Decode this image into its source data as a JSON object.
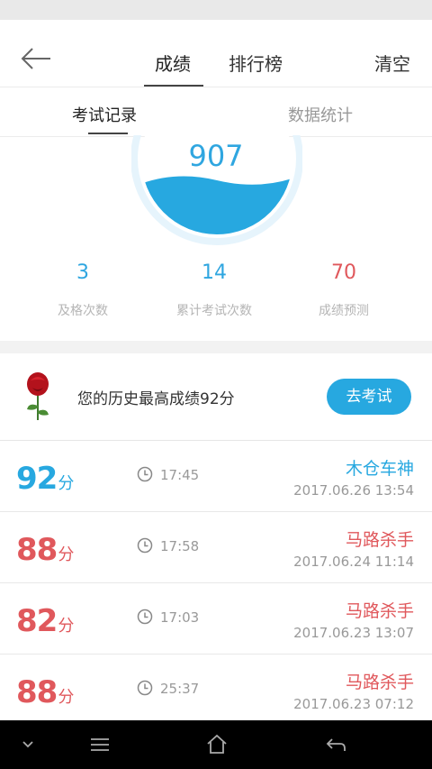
{
  "header": {
    "tabs": [
      {
        "label": "成绩",
        "active": true
      },
      {
        "label": "排行榜",
        "active": false
      }
    ],
    "clear_label": "清空"
  },
  "subtabs": [
    {
      "label": "考试记录",
      "active": true
    },
    {
      "label": "数据统计",
      "active": false
    }
  ],
  "gauge": {
    "score": "907",
    "fill_level": 0.35
  },
  "stats": [
    {
      "value": "3",
      "label": "及格次数",
      "color": "#2fa6e0"
    },
    {
      "value": "14",
      "label": "累计考试次数",
      "color": "#2fa6e0"
    },
    {
      "value": "70",
      "label": "成绩预测",
      "color": "#e0585c"
    }
  ],
  "best": {
    "text": "您的历史最高成绩92分",
    "button_label": "去考试"
  },
  "records": [
    {
      "score": "92",
      "unit": "分",
      "duration": "17:45",
      "title": "木仓车神",
      "date": "2017.06.26  13:54",
      "color": "blue"
    },
    {
      "score": "88",
      "unit": "分",
      "duration": "17:58",
      "title": "马路杀手",
      "date": "2017.06.24  11:14",
      "color": "red"
    },
    {
      "score": "82",
      "unit": "分",
      "duration": "17:03",
      "title": "马路杀手",
      "date": "2017.06.23  13:07",
      "color": "red"
    },
    {
      "score": "88",
      "unit": "分",
      "duration": "25:37",
      "title": "马路杀手",
      "date": "2017.06.23  07:12",
      "color": "red"
    }
  ],
  "colors": {
    "accent": "#27a8e0",
    "danger": "#e0585c"
  }
}
